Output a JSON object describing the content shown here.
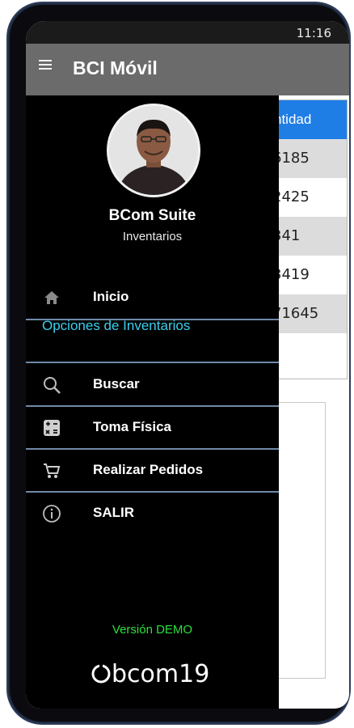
{
  "status": {
    "time": "11:16"
  },
  "appbar": {
    "title": "BCI Móvil",
    "menu_icon": "hamburger-menu-icon"
  },
  "table": {
    "header": "ntidad",
    "rows": [
      "6185",
      "2425",
      "341",
      "3419",
      "71645"
    ]
  },
  "drawer": {
    "user_name": "BCom Suite",
    "user_subtitle": "Inventarios",
    "items": [
      {
        "label": "Inicio",
        "icon": "home-icon"
      },
      {
        "label": "Buscar",
        "icon": "search-icon"
      },
      {
        "label": "Toma Física",
        "icon": "calculator-icon"
      },
      {
        "label": "Realizar Pedidos",
        "icon": "cart-icon"
      },
      {
        "label": "SALIR",
        "icon": "info-icon"
      }
    ],
    "section_header": "Opciones de Inventarios",
    "version": "Versión DEMO",
    "logo_text": "bcom19"
  },
  "colors": {
    "drawer_bg": "#000000",
    "appbar_bg": "#6b6b6b",
    "section_header": "#39d0ee",
    "separator": "#6f8aa8",
    "version": "#28e03a",
    "table_header": "#1f7de6"
  }
}
